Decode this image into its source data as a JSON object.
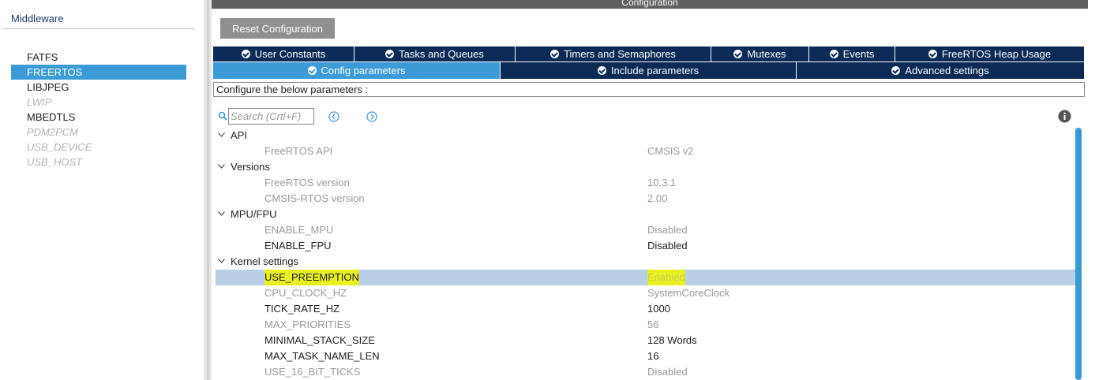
{
  "middleware": {
    "title": "Middleware",
    "items": [
      {
        "label": "FATFS",
        "state": "normal"
      },
      {
        "label": "FREERTOS",
        "state": "selected"
      },
      {
        "label": "LIBJPEG",
        "state": "normal"
      },
      {
        "label": "LWIP",
        "state": "disabled"
      },
      {
        "label": "MBEDTLS",
        "state": "normal"
      },
      {
        "label": "PDM2PCM",
        "state": "disabled"
      },
      {
        "label": "USB_DEVICE",
        "state": "disabled"
      },
      {
        "label": "USB_HOST",
        "state": "disabled"
      }
    ]
  },
  "configuration": {
    "header": "Configuration",
    "reset_label": "Reset Configuration",
    "tabs_row1": [
      "User Constants",
      "Tasks and Queues",
      "Timers and Semaphores",
      "Mutexes",
      "Events",
      "FreeRTOS Heap Usage"
    ],
    "tabs_row2": [
      "Config parameters",
      "Include parameters",
      "Advanced settings"
    ],
    "active_tab": "Config parameters",
    "instruction": "Configure the below parameters :",
    "search_placeholder": "Search (Crtl+F)",
    "groups": [
      {
        "name": "API",
        "params": [
          {
            "name": "FreeRTOS API",
            "value": "CMSIS v2",
            "editable": false
          }
        ]
      },
      {
        "name": "Versions",
        "params": [
          {
            "name": "FreeRTOS version",
            "value": "10.3.1",
            "editable": false
          },
          {
            "name": "CMSIS-RTOS version",
            "value": "2.00",
            "editable": false
          }
        ]
      },
      {
        "name": "MPU/FPU",
        "params": [
          {
            "name": "ENABLE_MPU",
            "value": "Disabled",
            "editable": false
          },
          {
            "name": "ENABLE_FPU",
            "value": "Disabled",
            "editable": true
          }
        ]
      },
      {
        "name": "Kernel settings",
        "params": [
          {
            "name": "USE_PREEMPTION",
            "value": "Enabled",
            "editable": true,
            "selected": true,
            "highlighted": true
          },
          {
            "name": "CPU_CLOCK_HZ",
            "value": "SystemCoreClock",
            "editable": false
          },
          {
            "name": "TICK_RATE_HZ",
            "value": "1000",
            "editable": true
          },
          {
            "name": "MAX_PRIORITIES",
            "value": "56",
            "editable": false
          },
          {
            "name": "MINIMAL_STACK_SIZE",
            "value": "128 Words",
            "editable": true
          },
          {
            "name": "MAX_TASK_NAME_LEN",
            "value": "16",
            "editable": true
          },
          {
            "name": "USE_16_BIT_TICKS",
            "value": "Disabled",
            "editable": false
          }
        ]
      }
    ]
  },
  "colors": {
    "selection_blue": "#3c9bd6",
    "tab_navy": "#0b2a55",
    "row_selected": "#b9cfe6",
    "highlight": "#e9f021"
  },
  "icons": [
    "search-icon",
    "arrow-left-circle-icon",
    "arrow-right-circle-icon",
    "info-icon",
    "check-circle-icon",
    "chevron-down-icon"
  ]
}
